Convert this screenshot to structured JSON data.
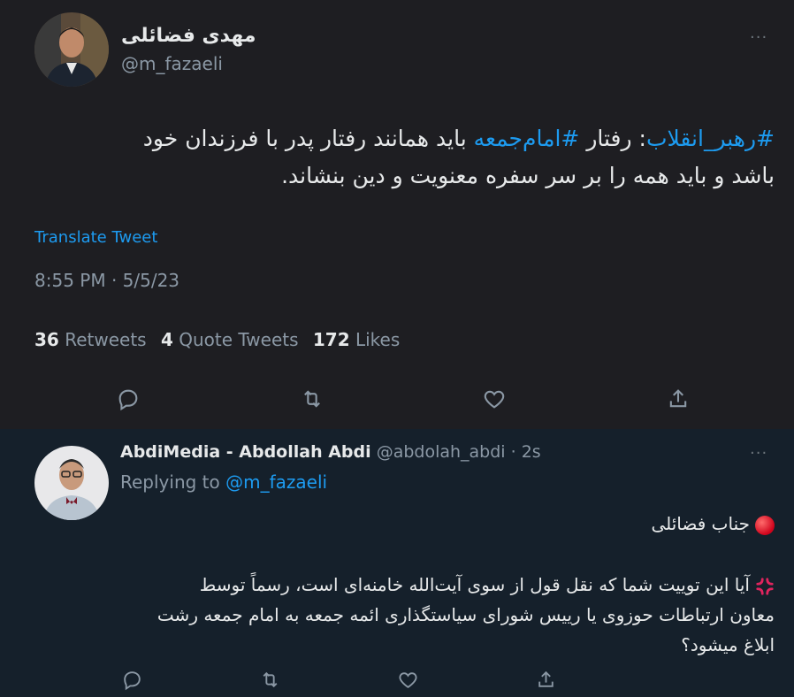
{
  "main_tweet": {
    "author_name": "مهدی فضائلی",
    "author_handle": "@m_fazaeli",
    "text_line1_hashtag1": "#رهبر_انقلاب",
    "text_line1_part1": ": رفتار ",
    "text_line1_hashtag2": "#امام‌جمعه",
    "text_line1_part2": " باید همانند رفتار پدر با فرزندان خود",
    "text_line2": "باشد و باید همه را بر سر سفره معنویت و دین بنشاند.",
    "translate_label": "Translate Tweet",
    "timestamp": "8:55 PM · 5/5/23",
    "stats": {
      "retweets_count": "36",
      "retweets_label": "Retweets",
      "quotes_count": "4",
      "quotes_label": "Quote Tweets",
      "likes_count": "172",
      "likes_label": "Likes"
    },
    "more_label": "···"
  },
  "reply": {
    "author_name": "AbdiMedia - Abdollah Abdi",
    "author_handle": "@abdolah_abdi · 2s",
    "replying_prefix": "Replying to ",
    "replying_mention": "@m_fazaeli",
    "line1": "جناب فضائلی",
    "line2": "آیا این توییت شما که نقل قول از سوی آیت‌الله خامنه‌ای است، رسماً توسط",
    "line3": "معاون ارتباطات حوزوی یا رییس شورای سیاستگذاری ائمه جمعه به امام جمعه رشت",
    "line4": "ابلاغ میشود؟",
    "more_label": "···"
  },
  "icons": {
    "reply": "reply-icon",
    "retweet": "retweet-icon",
    "like": "heart-icon",
    "share": "share-icon"
  },
  "colors": {
    "accent": "#1d9bf0",
    "secondary_text": "#8b98a5",
    "main_bg": "#1e1e22",
    "reply_bg": "#15202b"
  }
}
